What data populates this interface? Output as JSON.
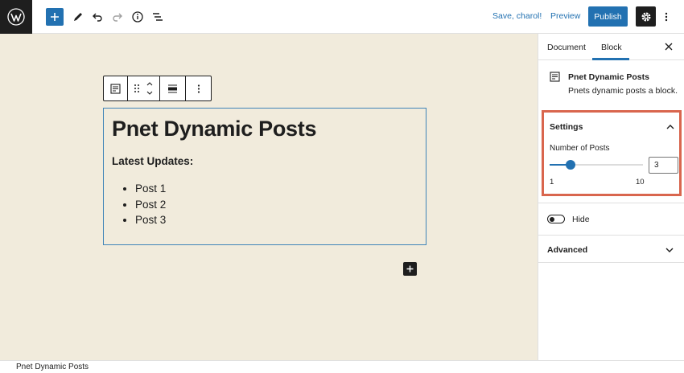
{
  "topbar": {
    "save_label": "Save, charol!",
    "preview_label": "Preview",
    "publish_label": "Publish"
  },
  "editor": {
    "block_title": "Pnet Dynamic Posts",
    "subheading": "Latest Updates:",
    "posts": [
      "Post 1",
      "Post 2",
      "Post 3"
    ]
  },
  "sidebar": {
    "tabs": [
      "Document",
      "Block"
    ],
    "active_tab": "Block",
    "block_card": {
      "title": "Pnet Dynamic Posts",
      "description": "Pnets dynamic posts a block."
    },
    "settings": {
      "title": "Settings",
      "number_label": "Number of Posts",
      "value": 3,
      "min": 1,
      "max": 10,
      "min_label": "1",
      "max_label": "10",
      "input_value": "3"
    },
    "hide_label": "Hide",
    "hide_enabled": false,
    "advanced_title": "Advanced"
  },
  "breadcrumb": "Pnet Dynamic Posts",
  "colors": {
    "accent": "#2271b1",
    "highlight_border": "#d9664e",
    "canvas_bg": "#f1ebdc",
    "dark": "#1e1e1e"
  }
}
